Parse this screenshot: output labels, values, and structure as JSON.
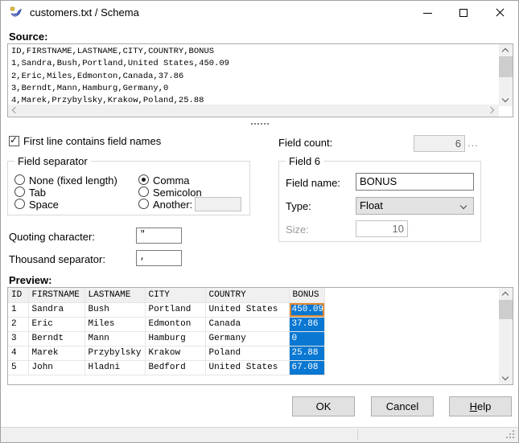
{
  "window": {
    "title": "customers.txt / Schema"
  },
  "source": {
    "label": "Source:",
    "lines": [
      "ID,FIRSTNAME,LASTNAME,CITY,COUNTRY,BONUS",
      "1,Sandra,Bush,Portland,United States,450.09",
      "2,Eric,Miles,Edmonton,Canada,37.86",
      "3,Berndt,Mann,Hamburg,Germany,0",
      "4,Marek,Przybylsky,Krakow,Poland,25.88"
    ]
  },
  "options": {
    "first_line_checkbox": {
      "label": "First line contains field names",
      "checked": true
    },
    "field_count": {
      "label": "Field count:",
      "value": "6",
      "more": "..."
    }
  },
  "field_separator": {
    "title": "Field separator",
    "radios": [
      {
        "label": "None (fixed length)",
        "selected": false
      },
      {
        "label": "Tab",
        "selected": false
      },
      {
        "label": "Space",
        "selected": false
      },
      {
        "label": "Comma",
        "selected": true
      },
      {
        "label": "Semicolon",
        "selected": false
      },
      {
        "label": "Another:",
        "selected": false
      }
    ],
    "another_value": ""
  },
  "field6": {
    "title": "Field 6",
    "field_name": {
      "label": "Field name:",
      "value": "BONUS"
    },
    "type": {
      "label": "Type:",
      "value": "Float"
    },
    "size": {
      "label": "Size:",
      "value": "10"
    }
  },
  "quoting": {
    "label": "Quoting character:",
    "value": "\""
  },
  "thousand": {
    "label": "Thousand separator:",
    "value": ","
  },
  "preview": {
    "label": "Preview:",
    "columns": [
      "ID",
      "FIRSTNAME",
      "LASTNAME",
      "CITY",
      "COUNTRY",
      "BONUS"
    ],
    "rows": [
      [
        "1",
        "Sandra",
        "Bush",
        "Portland",
        "United States",
        "450.09"
      ],
      [
        "2",
        "Eric",
        "Miles",
        "Edmonton",
        "Canada",
        "37.86"
      ],
      [
        "3",
        "Berndt",
        "Mann",
        "Hamburg",
        "Germany",
        "0"
      ],
      [
        "4",
        "Marek",
        "Przybylsky",
        "Krakow",
        "Poland",
        "25.88"
      ],
      [
        "5",
        "John",
        "Hladni",
        "Bedford",
        "United States",
        "67.08"
      ]
    ],
    "selected_column_index": 5,
    "focused_row_index": 0
  },
  "buttons": {
    "ok": "OK",
    "cancel": "Cancel",
    "help": "Help"
  },
  "colors": {
    "selection_blue": "#0a78d2",
    "focus_orange": "#e2882c"
  }
}
